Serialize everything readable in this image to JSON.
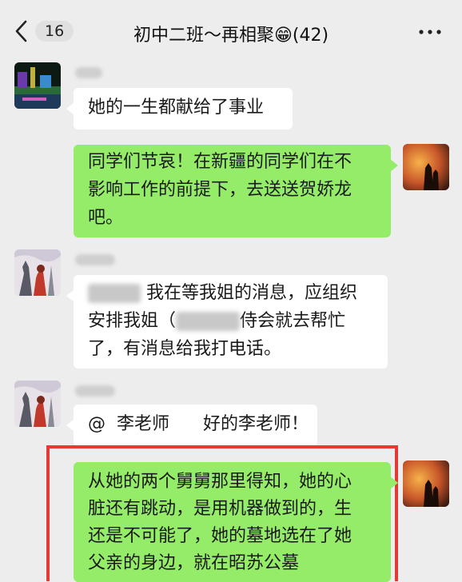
{
  "header": {
    "back_badge": "16",
    "title": "初中二班～再相聚",
    "title_emoji": "😁",
    "member_count": "(42)",
    "back_icon": "chevron-left-icon",
    "more_icon": "more-dots-icon"
  },
  "messages": [
    {
      "side": "in",
      "text": "她的一生都献给了事业"
    },
    {
      "side": "out",
      "lines": [
        "同学们节哀！在新疆的同学们在不",
        "影响工作的前提下，去送送贺娇龙",
        "吧。"
      ]
    },
    {
      "side": "in",
      "line1": "我在等我姐的消息，应组织",
      "line2_start": "安排我姐（",
      "line2_end": "侍会就去帮忙",
      "line3": "了，有消息给我打电话。"
    },
    {
      "side": "in",
      "mention": "@",
      "mention_name": "李老师",
      "text": "好的李老师！"
    },
    {
      "side": "out",
      "lines": [
        "从她的两个舅舅那里得知，她的心",
        "脏还有跳动，是用机器做到的，生",
        "还是不可能了，她的墓地选在了她",
        "父亲的身边，就在昭苏公墓"
      ]
    }
  ],
  "colors": {
    "background": "#ededed",
    "outgoing_bubble": "#95ec69",
    "incoming_bubble": "#ffffff",
    "highlight": "#e53935"
  }
}
